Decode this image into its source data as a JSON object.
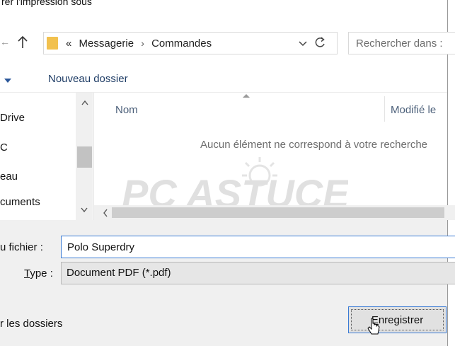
{
  "window": {
    "title": "rer l'impression sous"
  },
  "nav": {
    "back_glyph": "←",
    "forward_glyph": "→",
    "up_icon": "up-arrow-icon",
    "address": {
      "overflow": "«",
      "crumbs": [
        "Messagerie",
        "Commandes"
      ],
      "separator": "›"
    },
    "refresh_icon": "refresh-icon",
    "search_placeholder": "Rechercher dans :"
  },
  "toolbar": {
    "new_folder_label": "Nouveau dossier"
  },
  "nav_pane": {
    "items": [
      "Drive",
      "C",
      "eau",
      "cuments"
    ]
  },
  "file_list": {
    "columns": [
      {
        "label": "Nom"
      },
      {
        "label": "Modifié le"
      }
    ],
    "empty_message": "Aucun élément ne correspond à votre recherche"
  },
  "watermark": {
    "text": "PC ASTUCES"
  },
  "form": {
    "filename_label": "u fichier :",
    "filename_value": "Polo Superdry",
    "type_label_prefix": "T",
    "type_label_rest": "ype :",
    "type_value": "Document PDF (*.pdf)"
  },
  "footer": {
    "browse_label": "r les dossiers",
    "save_button_prefix": "E",
    "save_button_rest": "nregistrer"
  },
  "colors": {
    "accent": "#3a7bd5",
    "folder": "#f2c14e",
    "header_text": "#4c607a"
  }
}
